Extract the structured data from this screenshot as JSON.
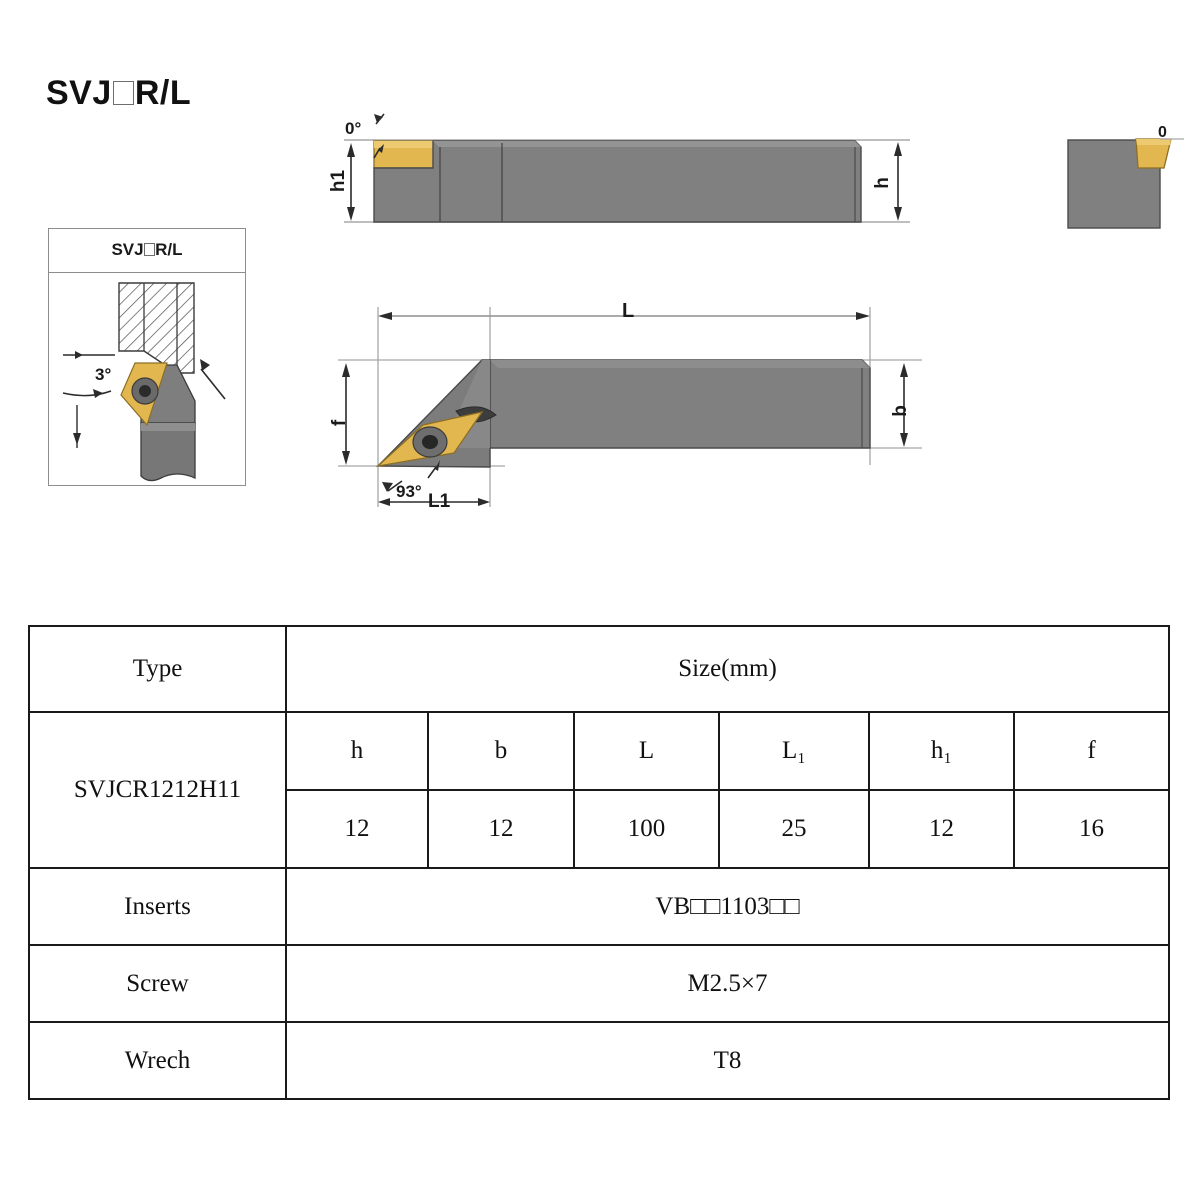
{
  "page": {
    "title": "SVJ□R/L",
    "background_color": "#ffffff"
  },
  "colors": {
    "insert_gold": "#e3b74f",
    "insert_gold_light": "#edc96f",
    "holder_gray": "#808080",
    "holder_gray_dark": "#6b6b6b",
    "holder_gray_light": "#949494",
    "line_black": "#1a1a1a",
    "line_gray": "#9a9a9a"
  },
  "inset": {
    "title": "SVJ□R/L",
    "angle_label": "3°"
  },
  "top_view": {
    "angle_label": "0°",
    "height_label": "h1",
    "shank_height_label": "h"
  },
  "end_view": {
    "angle_label": "0"
  },
  "main_view": {
    "length_label": "L",
    "overhang_label": "f",
    "width_label": "b",
    "lead_angle_label": "93°",
    "head_length_label": "L1"
  },
  "table": {
    "col_type_header": "Type",
    "col_size_header": "Size(mm)",
    "symbols": [
      "h",
      "b",
      "L",
      "L₁",
      "h₁",
      "f"
    ],
    "rows": [
      {
        "type": "SVJCR1212H11",
        "values": [
          "12",
          "12",
          "100",
          "25",
          "12",
          "16"
        ]
      }
    ],
    "extra_rows": [
      {
        "label": "Inserts",
        "value": "VB□□1103□□"
      },
      {
        "label": "Screw",
        "value": "M2.5×7"
      },
      {
        "label": "Wrech",
        "value": "T8"
      }
    ]
  }
}
